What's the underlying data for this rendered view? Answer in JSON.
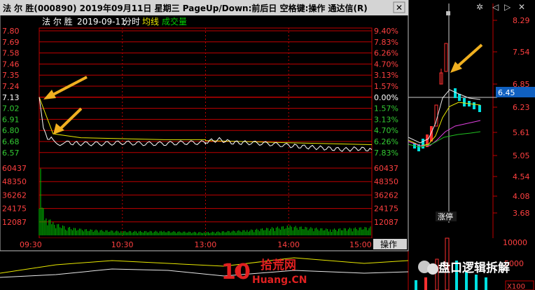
{
  "window": {
    "title": "法 尔 胜(000890)  2019年09月11日  星期三  PageUp/Down:前后日  空格键:操作  通达信(R)"
  },
  "popup": {
    "subtitle_name": "法 尔 胜",
    "subtitle_date": "2019-09-11",
    "subtitle_mode": "分时",
    "avg_label": "均线",
    "vol_label": "成交量",
    "price_ticks": [
      "7.80",
      "7.69",
      "7.58",
      "7.46",
      "7.35",
      "7.24",
      "7.13",
      "7.02",
      "6.91",
      "6.80",
      "6.68",
      "6.57"
    ],
    "pct_ticks": [
      "9.40%",
      "7.83%",
      "6.26%",
      "4.70%",
      "3.13%",
      "1.57%",
      "0.00%",
      "1.57%",
      "3.13%",
      "4.70%",
      "6.26%",
      "7.83%"
    ],
    "volume_ticks": [
      "60437",
      "48350",
      "36262",
      "24175",
      "12087"
    ],
    "time_ticks": [
      "09:30",
      "10:30",
      "13:00",
      "14:00",
      "15:00"
    ],
    "operate_label": "操作"
  },
  "right_chart": {
    "price_ticks": [
      "8.29",
      "7.54",
      "6.85",
      "6.23",
      "5.61",
      "5.05",
      "4.54",
      "4.08",
      "3.68"
    ],
    "current_price": "6.45",
    "vol_ticks": [
      "10000",
      "5000"
    ],
    "vol_unit": "X100",
    "event_label": "涨停"
  },
  "watermarks": {
    "logo_site_cn": "拾荒网",
    "logo_site_en": "Huang.CN",
    "wechat": "盘口逻辑拆解"
  },
  "colors": {
    "grid_red": "#c00000",
    "tick_red": "#ff4040",
    "tick_green": "#33cc33",
    "price_line": "#ffffff",
    "avg_line": "#e8e800",
    "volume": "#00cc00",
    "arrow": "#f0b020",
    "current_price_box": "#1060c0"
  },
  "chart_data": {
    "type": "line",
    "title": "",
    "subtitle": "法 尔 胜 2019-09-11 分时",
    "series": [
      {
        "name": "",
        "x": [
          "09:30",
          "09:33",
          "09:36",
          "09:40",
          "09:45",
          "09:50",
          "10:00",
          "10:15",
          "10:30",
          "10:45",
          "11:00",
          "11:15",
          "11:30",
          "13:00",
          "13:10",
          "13:20",
          "13:30",
          "13:45",
          "14:00",
          "14:10",
          "14:20",
          "14:30",
          "14:40",
          "14:50",
          "15:00"
        ],
        "values": [
          7.13,
          6.82,
          6.72,
          6.7,
          6.66,
          6.67,
          6.66,
          6.66,
          6.67,
          6.66,
          6.66,
          6.67,
          6.67,
          6.68,
          6.7,
          6.67,
          6.67,
          6.66,
          6.64,
          6.63,
          6.62,
          6.61,
          6.6,
          6.61,
          6.6
        ]
      },
      {
        "name": "均线",
        "x": [
          "09:30",
          "09:40",
          "10:00",
          "10:30",
          "11:00",
          "11:30",
          "13:00",
          "13:30",
          "14:00",
          "14:30",
          "15:00"
        ],
        "values": [
          7.13,
          6.76,
          6.72,
          6.71,
          6.7,
          6.7,
          6.69,
          6.68,
          6.67,
          6.66,
          6.65
        ]
      },
      {
        "name": "成交量",
        "x": [
          "09:30",
          "09:31",
          "09:32",
          "09:33",
          "09:35",
          "09:40",
          "09:50",
          "10:00",
          "10:30",
          "11:00",
          "11:30",
          "13:00",
          "13:30",
          "14:00",
          "14:30",
          "15:00"
        ],
        "values": [
          48000,
          60437,
          38000,
          26000,
          18000,
          12000,
          8000,
          6000,
          4000,
          4000,
          3000,
          3000,
          5000,
          9000,
          6000,
          8000
        ]
      }
    ],
    "ylim": [
      6.57,
      7.8
    ],
    "xlabel": "",
    "ylabel": ""
  }
}
